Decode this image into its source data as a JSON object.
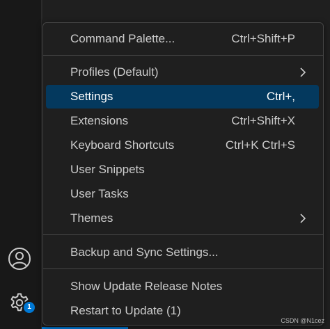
{
  "menu": {
    "items": [
      {
        "label": "Command Palette...",
        "keybinding": "Ctrl+Shift+P"
      },
      {
        "label": "Profiles (Default)",
        "submenu": true
      },
      {
        "label": "Settings",
        "keybinding": "Ctrl+,",
        "selected": true
      },
      {
        "label": "Extensions",
        "keybinding": "Ctrl+Shift+X"
      },
      {
        "label": "Keyboard Shortcuts",
        "keybinding": "Ctrl+K Ctrl+S"
      },
      {
        "label": "User Snippets"
      },
      {
        "label": "User Tasks"
      },
      {
        "label": "Themes",
        "submenu": true
      },
      {
        "label": "Backup and Sync Settings..."
      },
      {
        "label": "Show Update Release Notes"
      },
      {
        "label": "Restart to Update (1)"
      }
    ]
  },
  "activity_bar": {
    "accounts_icon": "account-icon",
    "manage_icon": "gear-icon",
    "manage_badge": "1"
  },
  "watermark": "CSDN @N1cez",
  "colors": {
    "background": "#1f1f1f",
    "selection": "#04395e",
    "badge": "#0078d4",
    "border": "#454545"
  }
}
